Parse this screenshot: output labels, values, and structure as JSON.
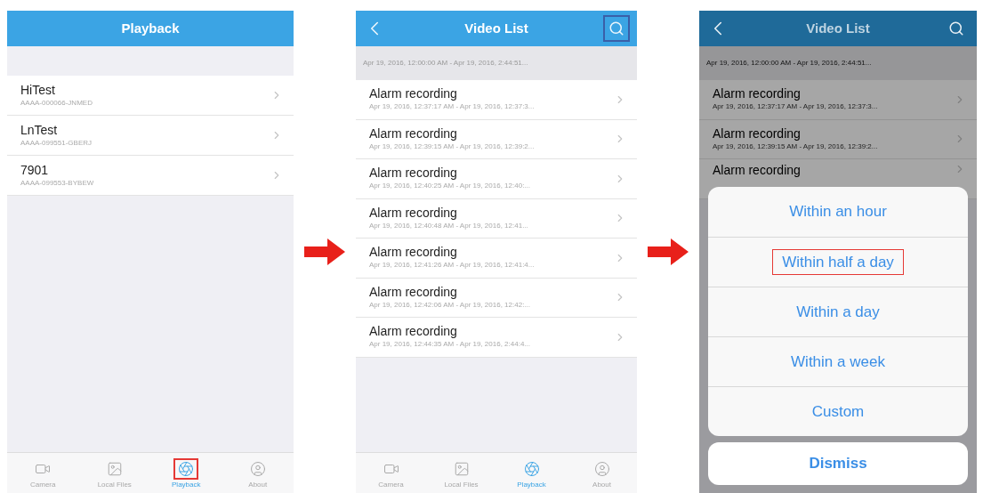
{
  "screens": [
    {
      "kind": "devices",
      "title": "Playback",
      "devices": [
        {
          "name": "HiTest",
          "serial": "AAAA-000066-JNMED"
        },
        {
          "name": "LnTest",
          "serial": "AAAA-099551-GBERJ"
        },
        {
          "name": "7901",
          "serial": "AAAA-099553-BYBEW"
        }
      ],
      "tabs": [
        {
          "label": "Camera",
          "selected": false,
          "highlighted": false
        },
        {
          "label": "Local Files",
          "selected": false,
          "highlighted": false
        },
        {
          "label": "Playback",
          "selected": true,
          "highlighted": true
        },
        {
          "label": "About",
          "selected": false,
          "highlighted": false
        }
      ]
    },
    {
      "kind": "videos",
      "title": "Video List",
      "search_highlighted": true,
      "range": "Apr 19, 2016, 12:00:00 AM - Apr 19, 2016, 2:44:51...",
      "recordings": [
        {
          "title": "Alarm recording",
          "time": "Apr 19, 2016, 12:37:17 AM - Apr 19, 2016, 12:37:3..."
        },
        {
          "title": "Alarm recording",
          "time": "Apr 19, 2016, 12:39:15 AM - Apr 19, 2016, 12:39:2..."
        },
        {
          "title": "Alarm recording",
          "time": "Apr 19, 2016, 12:40:25 AM - Apr 19, 2016, 12:40:..."
        },
        {
          "title": "Alarm recording",
          "time": "Apr 19, 2016, 12:40:48 AM - Apr 19, 2016, 12:41..."
        },
        {
          "title": "Alarm recording",
          "time": "Apr 19, 2016, 12:41:26 AM - Apr 19, 2016, 12:41:4..."
        },
        {
          "title": "Alarm recording",
          "time": "Apr 19, 2016, 12:42:06 AM - Apr 19, 2016, 12:42:..."
        },
        {
          "title": "Alarm recording",
          "time": "Apr 19, 2016, 12:44:35 AM - Apr 19, 2016, 2:44:4..."
        }
      ],
      "tabs": [
        {
          "label": "Camera",
          "selected": false,
          "highlighted": false
        },
        {
          "label": "Local Files",
          "selected": false,
          "highlighted": false
        },
        {
          "label": "Playback",
          "selected": true,
          "highlighted": false
        },
        {
          "label": "About",
          "selected": false,
          "highlighted": false
        }
      ]
    },
    {
      "kind": "filter",
      "title": "Video List",
      "search_highlighted": false,
      "range": "Apr 19, 2016, 12:00:00 AM - Apr 19, 2016, 2:44:51...",
      "recordings": [
        {
          "title": "Alarm recording",
          "time": "Apr 19, 2016, 12:37:17 AM - Apr 19, 2016, 12:37:3..."
        },
        {
          "title": "Alarm recording",
          "time": "Apr 19, 2016, 12:39:15 AM - Apr 19, 2016, 12:39:2..."
        },
        {
          "title": "Alarm recording"
        }
      ],
      "options": [
        {
          "label": "Within an hour",
          "highlighted": false
        },
        {
          "label": "Within half a day",
          "highlighted": true
        },
        {
          "label": "Within a day",
          "highlighted": false
        },
        {
          "label": "Within a week",
          "highlighted": false
        },
        {
          "label": "Custom",
          "highlighted": false
        }
      ],
      "dismiss": "Dismiss"
    }
  ]
}
